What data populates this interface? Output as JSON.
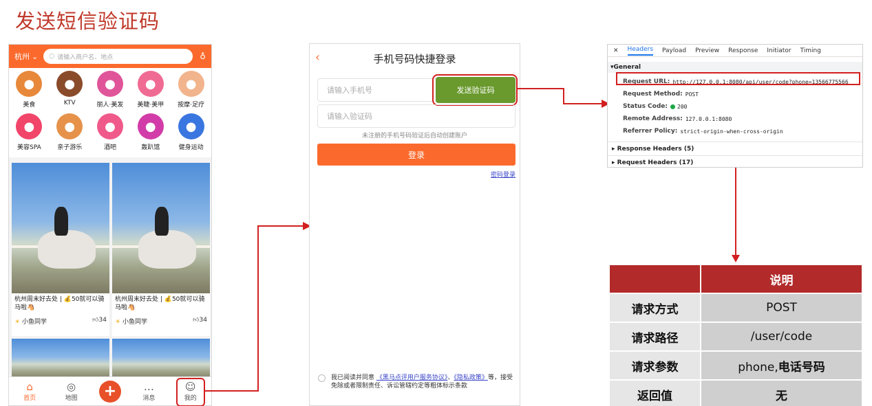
{
  "title": "发送短信验证码",
  "phone1": {
    "city": "杭州",
    "search_placeholder": "请输入商户名、地点",
    "categories": [
      {
        "label": "美食",
        "icon": "food-icon",
        "color": "#e8883a"
      },
      {
        "label": "KTV",
        "icon": "microphone-icon",
        "color": "#8a4b2a"
      },
      {
        "label": "丽人·美发",
        "icon": "hair-icon",
        "color": "#e0559a"
      },
      {
        "label": "美睫·美甲",
        "icon": "nail-icon",
        "color": "#f06b93"
      },
      {
        "label": "按摩·足疗",
        "icon": "massage-icon",
        "color": "#f2b48c"
      },
      {
        "label": "美容SPA",
        "icon": "spa-icon",
        "color": "#f2456a"
      },
      {
        "label": "亲子游乐",
        "icon": "family-icon",
        "color": "#e6924a"
      },
      {
        "label": "酒吧",
        "icon": "cocktail-icon",
        "color": "#f05a8a"
      },
      {
        "label": "轰趴馆",
        "icon": "mask-icon",
        "color": "#d23ca8"
      },
      {
        "label": "健身运动",
        "icon": "dumbbell-icon",
        "color": "#3a76e0"
      }
    ],
    "cards": [
      {
        "title": "杭州周末好去处 | 💰50就可以骑马啦🐴",
        "author": "小鱼同学",
        "likes": "34"
      },
      {
        "title": "杭州周末好去处 | 💰50就可以骑马啦🐴",
        "author": "小鱼同学",
        "likes": "34"
      }
    ],
    "tabs": [
      {
        "label": "首页",
        "icon": "home-icon",
        "glyph": "⌂"
      },
      {
        "label": "地图",
        "icon": "map-icon",
        "glyph": "◎"
      },
      {
        "label": "",
        "icon": "plus-icon",
        "glyph": "+"
      },
      {
        "label": "消息",
        "icon": "message-icon",
        "glyph": "…"
      },
      {
        "label": "我的",
        "icon": "user-icon",
        "glyph": "☺"
      }
    ]
  },
  "phone2": {
    "header": "手机号码快捷登录",
    "phone_placeholder": "请输入手机号",
    "send_code": "发送验证码",
    "code_placeholder": "请输入验证码",
    "hint": "未注册的手机号码验证后自动创建账户",
    "login": "登录",
    "pwd_login": "密码登录",
    "agree_prefix": "我已阅读并同意",
    "agreement": "《黑马点评用户服务协议》",
    "sep": "、",
    "privacy": "《隐私政策》",
    "agree_suffix": "等，接受免除或者限制责任、诉讼管辖约定等粗体标示条款"
  },
  "devtools": {
    "tabs": [
      "Headers",
      "Payload",
      "Preview",
      "Response",
      "Initiator",
      "Timing"
    ],
    "general": "General",
    "rows": [
      {
        "k": "Request URL:",
        "v": "http://127.0.0.1:8080/api/user/code?phone=13566775566"
      },
      {
        "k": "Request Method:",
        "v": "POST"
      },
      {
        "k": "Status Code:",
        "v": "200"
      },
      {
        "k": "Remote Address:",
        "v": "127.0.0.1:8080"
      },
      {
        "k": "Referrer Policy:",
        "v": "strict-origin-when-cross-origin"
      }
    ],
    "response_headers": "Response Headers (5)",
    "request_headers": "Request Headers (17)"
  },
  "table": {
    "header": [
      "",
      "说明"
    ],
    "rows": [
      {
        "key": "请求方式",
        "val": "POST"
      },
      {
        "key": "请求路径",
        "val": "/user/code"
      },
      {
        "key": "请求参数",
        "val_a": "phone,",
        "val_b": "电话号码"
      },
      {
        "key": "返回值",
        "val": "无"
      }
    ]
  }
}
